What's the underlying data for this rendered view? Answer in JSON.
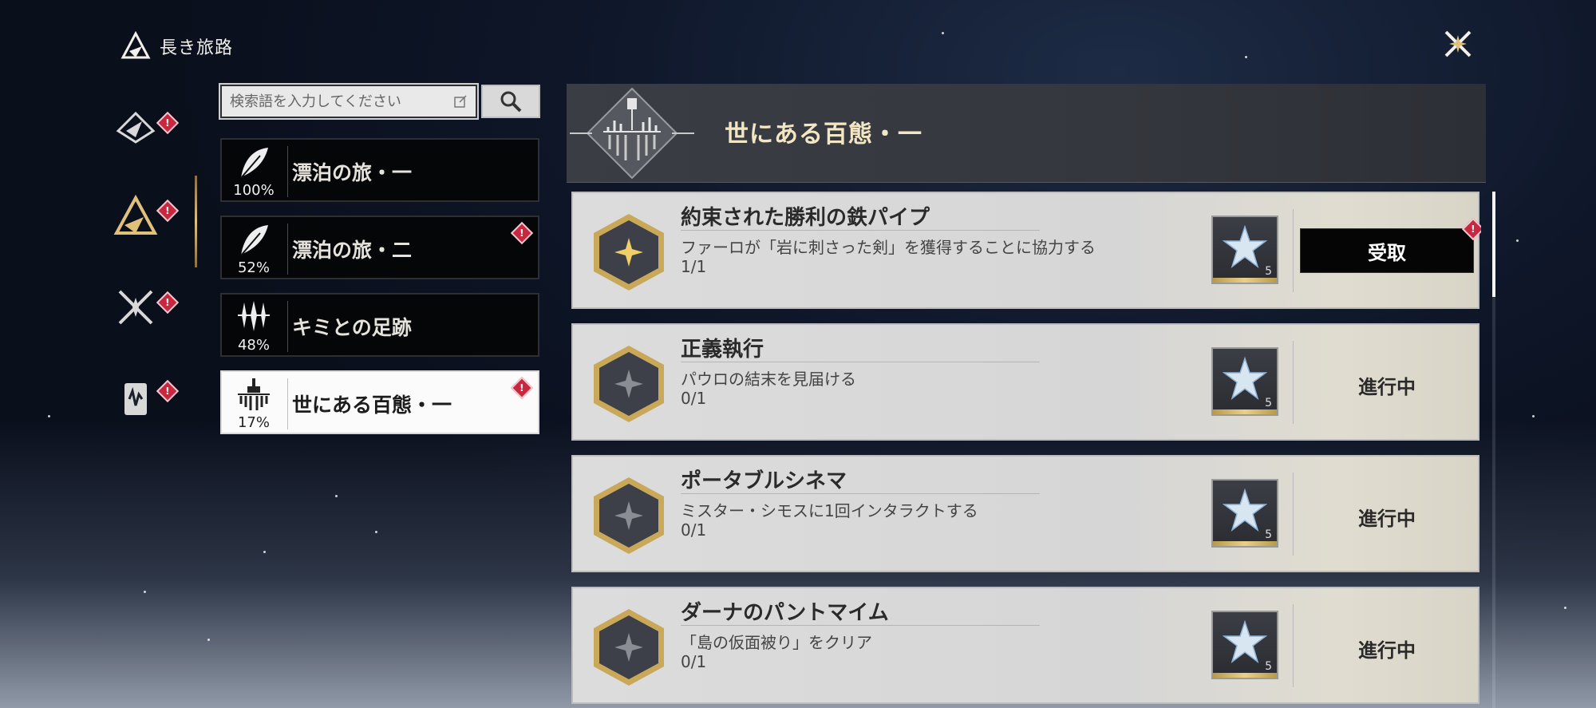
{
  "header": {
    "title": "長き旅路"
  },
  "search": {
    "placeholder": "検索語を入力してください"
  },
  "nav": [
    {
      "icon": "gear-star-icon",
      "badge": "!"
    },
    {
      "icon": "triangle-emblem-icon",
      "badge": "!",
      "active": true
    },
    {
      "icon": "crossed-swords-icon",
      "badge": "!"
    },
    {
      "icon": "music-card-icon",
      "badge": "!"
    }
  ],
  "journeys": [
    {
      "name": "漂泊の旅・一",
      "percent": "100%",
      "icon": "feather-icon",
      "badge": ""
    },
    {
      "name": "漂泊の旅・二",
      "percent": "52%",
      "icon": "feather-icon",
      "badge": "!"
    },
    {
      "name": "キミとの足跡",
      "percent": "48%",
      "icon": "sparkles-icon",
      "badge": ""
    },
    {
      "name": "世にある百態・一",
      "percent": "17%",
      "icon": "city-skyline-icon",
      "badge": "!",
      "active": true
    }
  ],
  "banner": {
    "title": "世にある百態・一"
  },
  "quests": [
    {
      "title": "約束された勝利の鉄パイプ",
      "desc": "ファーロが「岩に刺さった剣」を獲得することに協力する",
      "progress": "1/1",
      "reward_count": "5",
      "action": "受取",
      "action_badge": "!"
    },
    {
      "title": "正義執行",
      "desc": "パウロの結末を見届ける",
      "progress": "0/1",
      "reward_count": "5",
      "status": "進行中"
    },
    {
      "title": "ポータブルシネマ",
      "desc": "ミスター・シモスに1回インタラクトする",
      "progress": "0/1",
      "reward_count": "5",
      "status": "進行中"
    },
    {
      "title": "ダーナのパントマイム",
      "desc": "「島の仮面被り」をクリア",
      "progress": "0/1",
      "reward_count": "5",
      "status": "進行中"
    }
  ],
  "colors": {
    "accent_gold": "#e1c07a",
    "badge_red": "#c8283f",
    "claim_bg": "#050505"
  }
}
